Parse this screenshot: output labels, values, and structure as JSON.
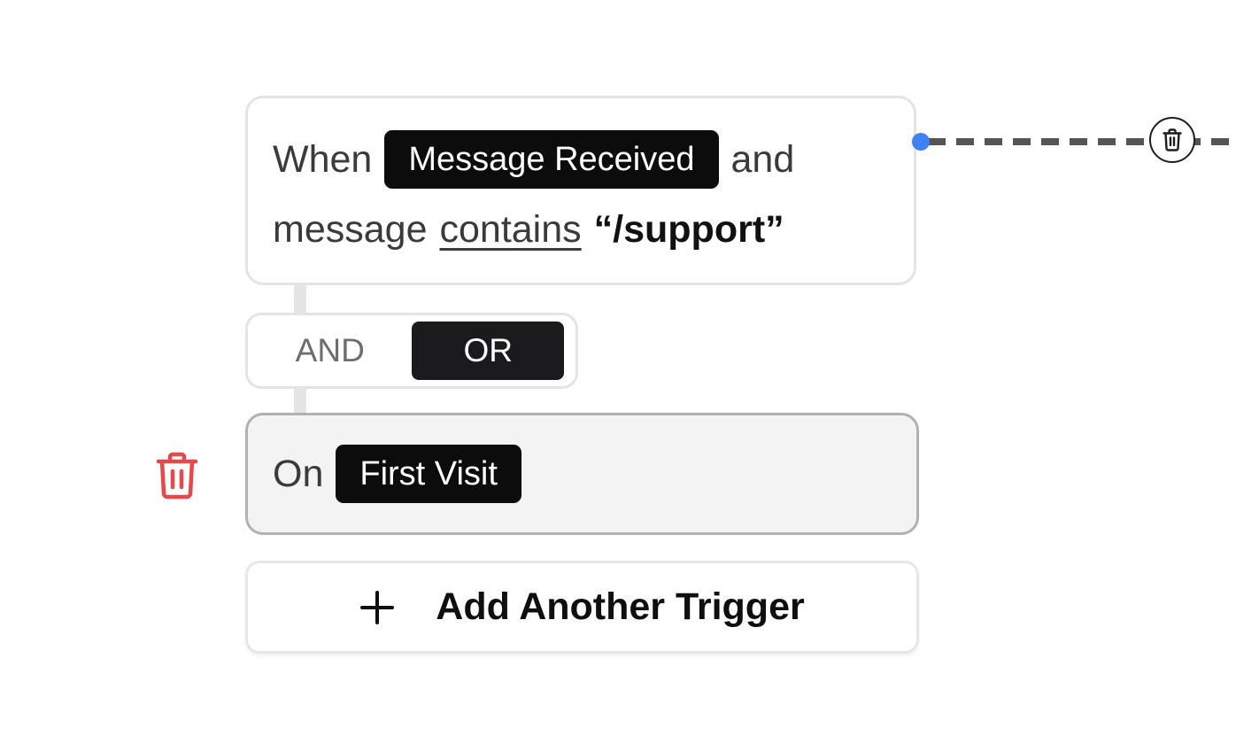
{
  "trigger": {
    "when_label": "When",
    "event_pill": "Message Received",
    "and_label": "and",
    "subject": "message",
    "operator": "contains",
    "value": "“/support”"
  },
  "logic_toggle": {
    "options": [
      "AND",
      "OR"
    ],
    "selected": "OR"
  },
  "second_trigger": {
    "prefix": "On",
    "event_pill": "First Visit"
  },
  "add_button": {
    "label": "Add Another Trigger",
    "icon": "plus-icon"
  },
  "icons": {
    "delete_trigger": "trash-icon",
    "edge_delete": "trash-icon"
  },
  "colors": {
    "pill_bg": "#0c0c0d",
    "selected_card_bg": "#f3f3f3",
    "delete_red": "#e5484d",
    "handle_blue": "#3e82f7",
    "edge_gray": "#555555"
  }
}
